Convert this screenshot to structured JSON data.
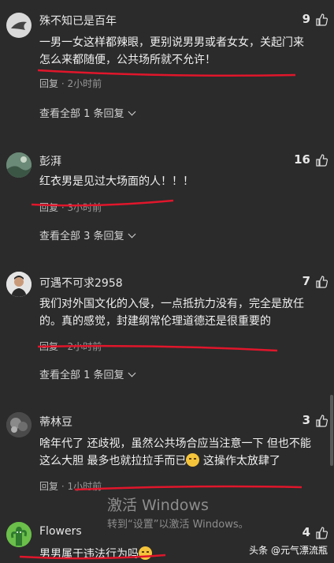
{
  "comments": [
    {
      "username": "殊不知已是百年",
      "likes": "9",
      "text": "一男一女这样都辣眼，更别说男男或者女女，关起门来怎么来都随便，公共场所就不允许！",
      "reply_label": "回复",
      "time": "2小时前",
      "view_all": "查看全部 1 条回复"
    },
    {
      "username": "彭湃",
      "likes": "16",
      "text": "红衣男是见过大场面的人！！！",
      "reply_label": "回复",
      "time": "3小时前",
      "view_all": "查看全部 3 条回复"
    },
    {
      "username": "可遇不可求2958",
      "likes": "7",
      "text": "我们对外国文化的入侵，一点抵抗力没有，完全是放任的。真的感觉，封建纲常伦理道德还是很重要的",
      "reply_label": "回复",
      "time": "2小时前",
      "view_all": "查看全部 1 条回复"
    },
    {
      "username": "蒂林豆",
      "likes": "3",
      "text_before_emoji": "啥年代了 还歧视，虽然公共场合应当注意一下 但也不能这么大胆 最多也就拉拉手而已",
      "text_after_emoji": " 这操作太放肆了",
      "reply_label": "回复",
      "time": "1小时前"
    },
    {
      "username": "Flowers",
      "likes": "4",
      "text": "男男属于违法行为吗"
    }
  ],
  "watermark": {
    "title": "激活 Windows",
    "subtitle": "转到“设置”以激活 Windows。"
  },
  "source": "头条 @元气漂流瓶",
  "colors": {
    "background": "#2b2b2b",
    "annotation": "#e0162b"
  }
}
